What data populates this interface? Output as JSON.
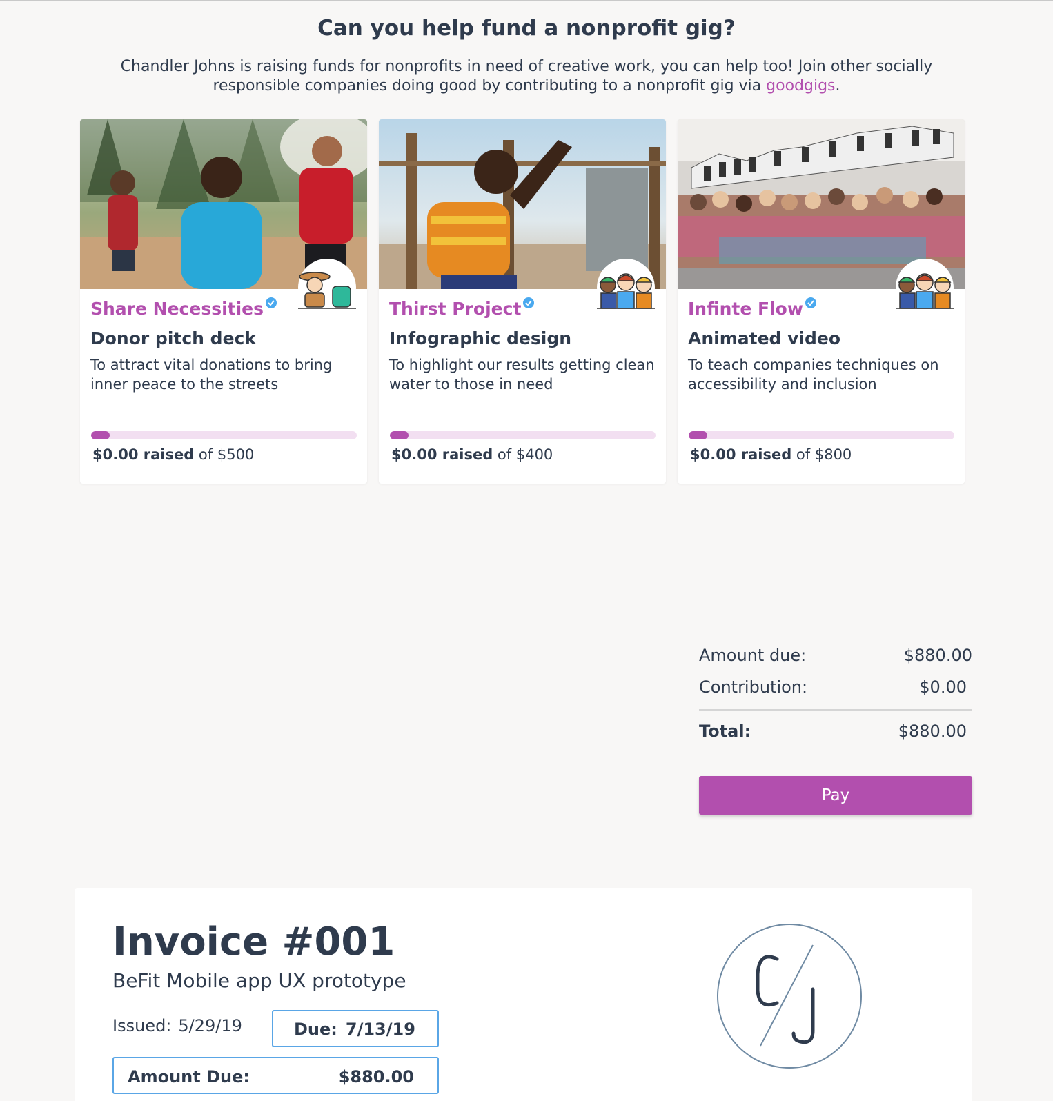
{
  "header": {
    "title": "Can you help fund a nonprofit gig?",
    "intro_text": "Chandler Johns is raising funds for nonprofits in need of creative work, you can help too! Join other socially responsible companies doing good by contributing to a nonprofit gig via ",
    "intro_link": "goodgigs",
    "intro_end": "."
  },
  "cards": [
    {
      "org": "Share Necessities",
      "title": "Donor pitch deck",
      "description": "To attract vital donations to bring inner peace to the streets",
      "raised": "$0.00 raised",
      "goal_text": " of $500",
      "progress_fraction": 0.07
    },
    {
      "org": "Thirst Project",
      "title": "Infographic design",
      "description": "To highlight our results getting clean water to those in need",
      "raised": "$0.00 raised",
      "goal_text": " of $400",
      "progress_fraction": 0.07
    },
    {
      "org": "Infinte Flow",
      "title": "Animated video",
      "description": "To teach companies techniques on accessibility and inclusion",
      "raised": "$0.00 raised",
      "goal_text": " of $800",
      "progress_fraction": 0.07
    }
  ],
  "summary": {
    "amount_due_label": "Amount due:",
    "amount_due_value": "$880.00",
    "contribution_label": "Contribution:",
    "contribution_value": "$0.00",
    "total_label": "Total:",
    "total_value": "$880.00",
    "pay_label": "Pay"
  },
  "invoice": {
    "title": "Invoice #001",
    "subtitle": "BeFit Mobile app UX prototype",
    "issued_label": "Issued:",
    "issued_date": "5/29/19",
    "due_label": "Due:",
    "due_date": "7/13/19",
    "amount_due_label": "Amount Due:",
    "amount_due_value": "$880.00",
    "logo_text": "C/J"
  },
  "colors": {
    "accent": "#b24fae",
    "text": "#2f3b4d",
    "progress_track": "#f2dff1",
    "box_border": "#5aa6e6",
    "background": "#f8f7f6"
  }
}
